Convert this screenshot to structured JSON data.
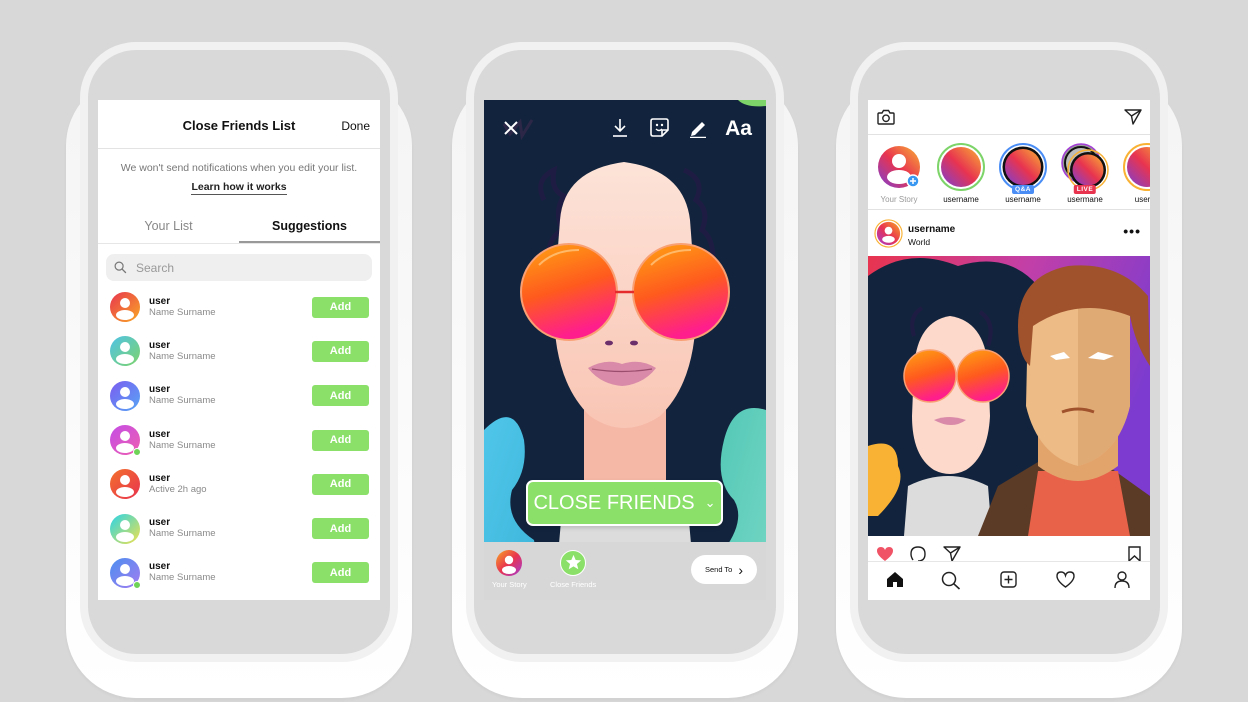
{
  "phones": {
    "close_friends_list": {
      "header": {
        "title": "Close Friends List",
        "done_label": "Done"
      },
      "note": "We won't send notifications when you edit your list.",
      "learn_link": "Learn how it works",
      "tabs": [
        {
          "label": "Your List",
          "active": false
        },
        {
          "label": "Suggestions",
          "active": true
        }
      ],
      "search": {
        "placeholder": "Search",
        "icon": "search-icon"
      },
      "add_label": "Add",
      "rows": [
        {
          "user": "user",
          "subtitle": "Name Surname",
          "online": false,
          "gradient": [
            "#e8344f",
            "#f9a825"
          ]
        },
        {
          "user": "user",
          "subtitle": "Name Surname",
          "online": false,
          "gradient": [
            "#4fc3e8",
            "#7ed36a"
          ]
        },
        {
          "user": "user",
          "subtitle": "Name Surname",
          "online": false,
          "gradient": [
            "#7b5cf0",
            "#58a6f5"
          ]
        },
        {
          "user": "user",
          "subtitle": "Name Surname",
          "online": true,
          "gradient": [
            "#c34de6",
            "#ef5fb0"
          ]
        },
        {
          "user": "user",
          "subtitle": "Active 2h ago",
          "online": false,
          "gradient": [
            "#f3702c",
            "#e8344f"
          ]
        },
        {
          "user": "user",
          "subtitle": "Name Surname",
          "online": false,
          "gradient": [
            "#28d4e8",
            "#f2e14b"
          ]
        },
        {
          "user": "user",
          "subtitle": "Name Surname",
          "online": true,
          "gradient": [
            "#4b8ff0",
            "#a37cf0"
          ]
        }
      ]
    },
    "story_composer": {
      "toolbar": [
        "close-icon",
        "download-icon",
        "sticker-icon",
        "draw-icon",
        "text-icon"
      ],
      "text_tool_label": "Aa",
      "audience_pill": {
        "label": "CLOSE FRIENDS",
        "icon": "chevron-down-icon"
      },
      "bottom": {
        "your_story_label": "Your Story",
        "close_friends_label": "Close Friends",
        "send_to_label": "Send To"
      }
    },
    "feed": {
      "top_icons": [
        "camera-icon",
        "direct-message-icon"
      ],
      "stories": [
        {
          "label": "Your Story",
          "type": "own"
        },
        {
          "label": "username",
          "type": "close-friends"
        },
        {
          "label": "username",
          "type": "qa",
          "badge": "Q&A"
        },
        {
          "label": "usermane",
          "type": "live",
          "badge": "LIVE"
        },
        {
          "label": "userna",
          "type": "normal"
        }
      ],
      "post": {
        "username": "username",
        "location": "World",
        "more_icon": "•••"
      },
      "post_actions": [
        "heart-filled-icon",
        "comment-icon",
        "share-icon",
        "bookmark-icon"
      ],
      "tab_bar": [
        "home-icon",
        "search-icon",
        "add-post-icon",
        "activity-heart-icon",
        "profile-icon"
      ]
    }
  },
  "colors": {
    "background": "#d8d8d8",
    "accent_green": "#8be06a",
    "story_bg": "#12243d",
    "like_red": "#f05365",
    "qa_badge": "#4a8ef5",
    "live_badge": "#e8344f"
  }
}
